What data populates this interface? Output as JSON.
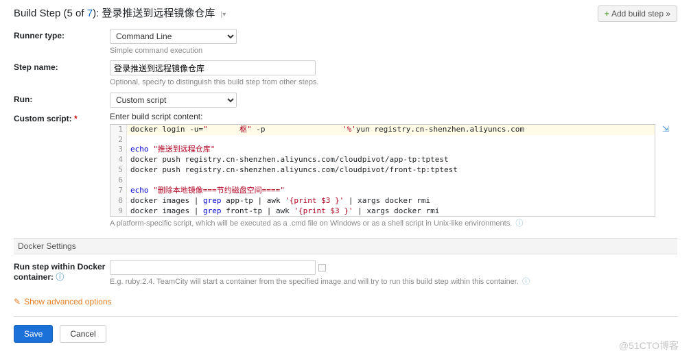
{
  "header": {
    "title_prefix": "Build Step (",
    "step_current": "5",
    "step_mid": " of ",
    "step_total": "7",
    "title_suffix": "): 登录推送到远程镜像仓库",
    "add_button": "Add build step »"
  },
  "form": {
    "runner_type_label": "Runner type:",
    "runner_type_value": "Command Line",
    "runner_type_hint": "Simple command execution",
    "step_name_label": "Step name:",
    "step_name_value": "登录推送到远程镜像仓库",
    "step_name_hint": "Optional, specify to distinguish this build step from other steps.",
    "run_label": "Run:",
    "run_value": "Custom script",
    "custom_script_label": "Custom script:",
    "script_hint": "Enter build script content:",
    "script_platform_hint": "A platform-specific script, which will be executed as a .cmd file on Windows or as a shell script in Unix-like environments."
  },
  "script_lines": [
    {
      "n": "1",
      "html": "docker login -u=<span class='str'>\"       枢\"</span> -p                 <span class='str'>'%'</span>yun registry.cn-shenzhen.aliyuncs.com"
    },
    {
      "n": "2",
      "html": ""
    },
    {
      "n": "3",
      "html": "<span class='kw'>echo</span> <span class='str'>\"推送到远程仓库\"</span>"
    },
    {
      "n": "4",
      "html": "docker push registry.cn-shenzhen.aliyuncs.com/cloudpivot/app-tp:tptest"
    },
    {
      "n": "5",
      "html": "docker push registry.cn-shenzhen.aliyuncs.com/cloudpivot/front-tp:tptest"
    },
    {
      "n": "6",
      "html": ""
    },
    {
      "n": "7",
      "html": "<span class='kw'>echo</span> <span class='str'>\"删除本地镜像===节约磁盘空间====\"</span>"
    },
    {
      "n": "8",
      "html": "docker images | <span class='kw'>grep</span> app-tp | awk <span class='str'>'{print $3 }'</span> | xargs docker rmi"
    },
    {
      "n": "9",
      "html": "docker images | <span class='kw'>grep</span> front-tp | awk <span class='str'>'{print $3 }'</span> | xargs docker rmi"
    }
  ],
  "docker": {
    "section_title": "Docker Settings",
    "label": "Run step within Docker container:",
    "value": "",
    "hint": "E.g. ruby:2.4. TeamCity will start a container from the specified image and will try to run this build step within this container."
  },
  "advanced_label": "Show advanced options",
  "buttons": {
    "save": "Save",
    "cancel": "Cancel"
  },
  "watermark": "@51CTO博客"
}
